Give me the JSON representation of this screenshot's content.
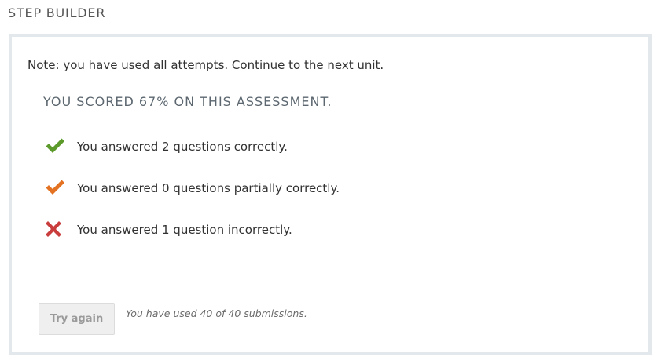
{
  "block": {
    "title": "STEP BUILDER"
  },
  "note": "Note: you have used all attempts. Continue to the next unit.",
  "assessment": {
    "score_heading": "YOU SCORED 67% ON THIS ASSESSMENT.",
    "score_percent": 67,
    "results": [
      {
        "icon": "checkmark-correct-icon",
        "color": "#5b9a2b",
        "text": "You answered 2 questions correctly."
      },
      {
        "icon": "checkmark-partial-icon",
        "color": "#e37222",
        "text": "You answered 0 questions partially correctly."
      },
      {
        "icon": "x-incorrect-icon",
        "color": "#c93d3d",
        "text": "You answered 1 question incorrectly."
      }
    ]
  },
  "actions": {
    "try_again_label": "Try again",
    "try_again_disabled": true,
    "submissions_text": "You have used 40 of 40 submissions."
  }
}
